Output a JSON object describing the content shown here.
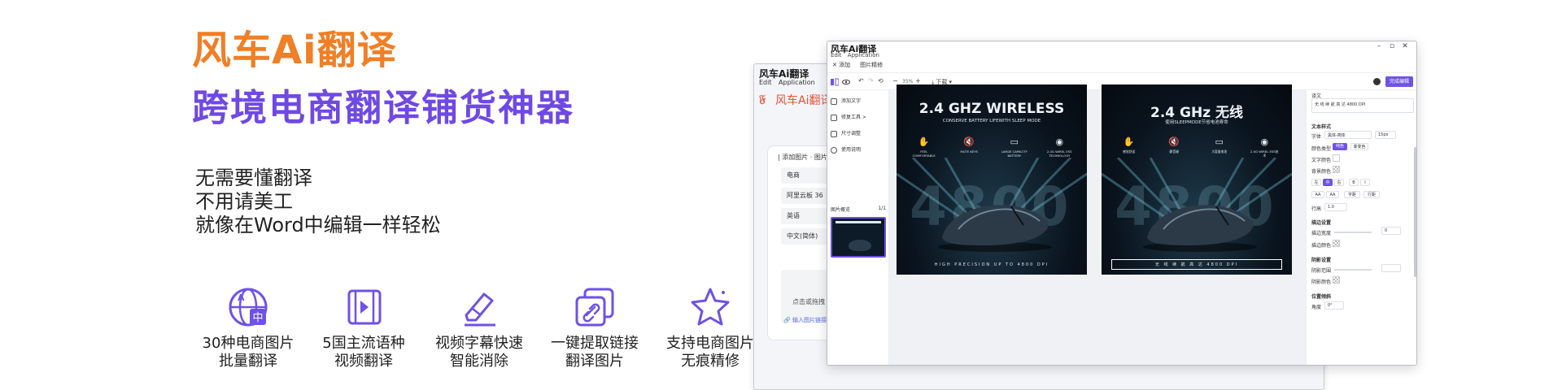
{
  "hero": {
    "brand": "风车Ai翻译",
    "tagline": "跨境电商翻译铺货神器",
    "benefits": [
      "无需要懂翻译",
      "不用请美工",
      "就像在Word中编辑一样轻松"
    ]
  },
  "features": [
    {
      "icon": "globe-translate-icon",
      "line1": "30种电商图片",
      "line2": "批量翻译"
    },
    {
      "icon": "video-play-icon",
      "line1": "5国主流语种",
      "line2": "视频翻译"
    },
    {
      "icon": "eraser-icon",
      "line1": "视频字幕快速",
      "line2": "智能消除"
    },
    {
      "icon": "link-icon",
      "line1": "一键提取链接",
      "line2": "翻译图片"
    },
    {
      "icon": "star-icon",
      "line1": "支持电商图片",
      "line2": "无痕精修"
    }
  ],
  "back_window": {
    "title": "风车Ai翻译",
    "menu": [
      "Edit",
      "Application"
    ],
    "logo_text": "风车Ai翻译",
    "logo_glyph": "𝔉",
    "card_header": "| 添加图片 · 图片",
    "fields": [
      "电商",
      "阿里云板  36",
      "英语",
      "中文(简体)"
    ],
    "dropzone": "点击或拖拽",
    "link": "🔗 输入图片链接"
  },
  "front_window": {
    "title": "风车Ai翻译",
    "menu": [
      "Edit",
      "Application"
    ],
    "window_controls": [
      "–",
      "▫",
      "✕"
    ],
    "tabs": [
      "✕ 添加",
      "图片精修"
    ],
    "toolbar": {
      "undo": "↶",
      "redo": "↷",
      "reset": "⟲",
      "zoom_minus": "−",
      "zoom": "35%",
      "zoom_plus": "+",
      "download": "⤓ 下载 ▾",
      "finish": "完成编辑"
    },
    "sidebar": {
      "items": [
        "添加文字",
        "修复工具 >",
        "尺寸调整",
        "使用说明"
      ],
      "list_header": "图片概览",
      "list_count": "1/1"
    },
    "right_panel": {
      "translation_label": "译文",
      "translation_value": "无 线 续 航 高 达  4800  DPI",
      "text_style": "文本样式",
      "font_label": "字体",
      "font_value": "黑体-简体",
      "size_value": "15px",
      "color_type_label": "颜色类型",
      "color_type_options": [
        "纯色",
        "渐变色"
      ],
      "text_color_label": "文字颜色",
      "bg_color_label": "背景颜色",
      "align_options": [
        "左",
        "中",
        "右",
        "B",
        "I"
      ],
      "spacing_options": [
        "AA",
        "AA",
        "字距",
        "行距"
      ],
      "line_height_label": "行高",
      "line_height_value": "1.0",
      "stroke_section": "描边设置",
      "stroke_width_label": "描边宽度",
      "stroke_width_value": "0",
      "stroke_color_label": "描边颜色",
      "shadow_section": "阴影设置",
      "shadow_range_label": "阴影范围",
      "shadow_color_label": "阴影颜色",
      "rotate_section": "位置倾斜",
      "angle_label": "角度",
      "angle_value": "0°"
    }
  },
  "products": [
    {
      "headline": "2.4 GHZ WIRELESS",
      "subline": "CONSERVE BATTERY LIFEWITH SLEEP MODE",
      "icons": [
        {
          "glyph": "✋",
          "text": "FEEL COMFORTABLE"
        },
        {
          "glyph": "🔇",
          "text": "MUTE KEYS"
        },
        {
          "glyph": "▭",
          "text": "LARGE CAPACITY BATTERY"
        },
        {
          "glyph": "◉",
          "text": "2.4G WIREL ESS TECHNOLOGY"
        }
      ],
      "big_number": "4800",
      "bottom_text": "HIGH PRECISION UP TO 4800 DPI"
    },
    {
      "headline": "2.4 GHz 无线",
      "subline": "使用SLEEPMODE节省电池寿命",
      "icons": [
        {
          "glyph": "✋",
          "text": "感觉舒适"
        },
        {
          "glyph": "🔇",
          "text": "静音键"
        },
        {
          "glyph": "▭",
          "text": "大容量电池"
        },
        {
          "glyph": "◉",
          "text": "2.5G WIREL ESS技术"
        }
      ],
      "big_number": "4800",
      "bottom_text": "无 线 续 航 高 达  4800  DPI"
    }
  ]
}
